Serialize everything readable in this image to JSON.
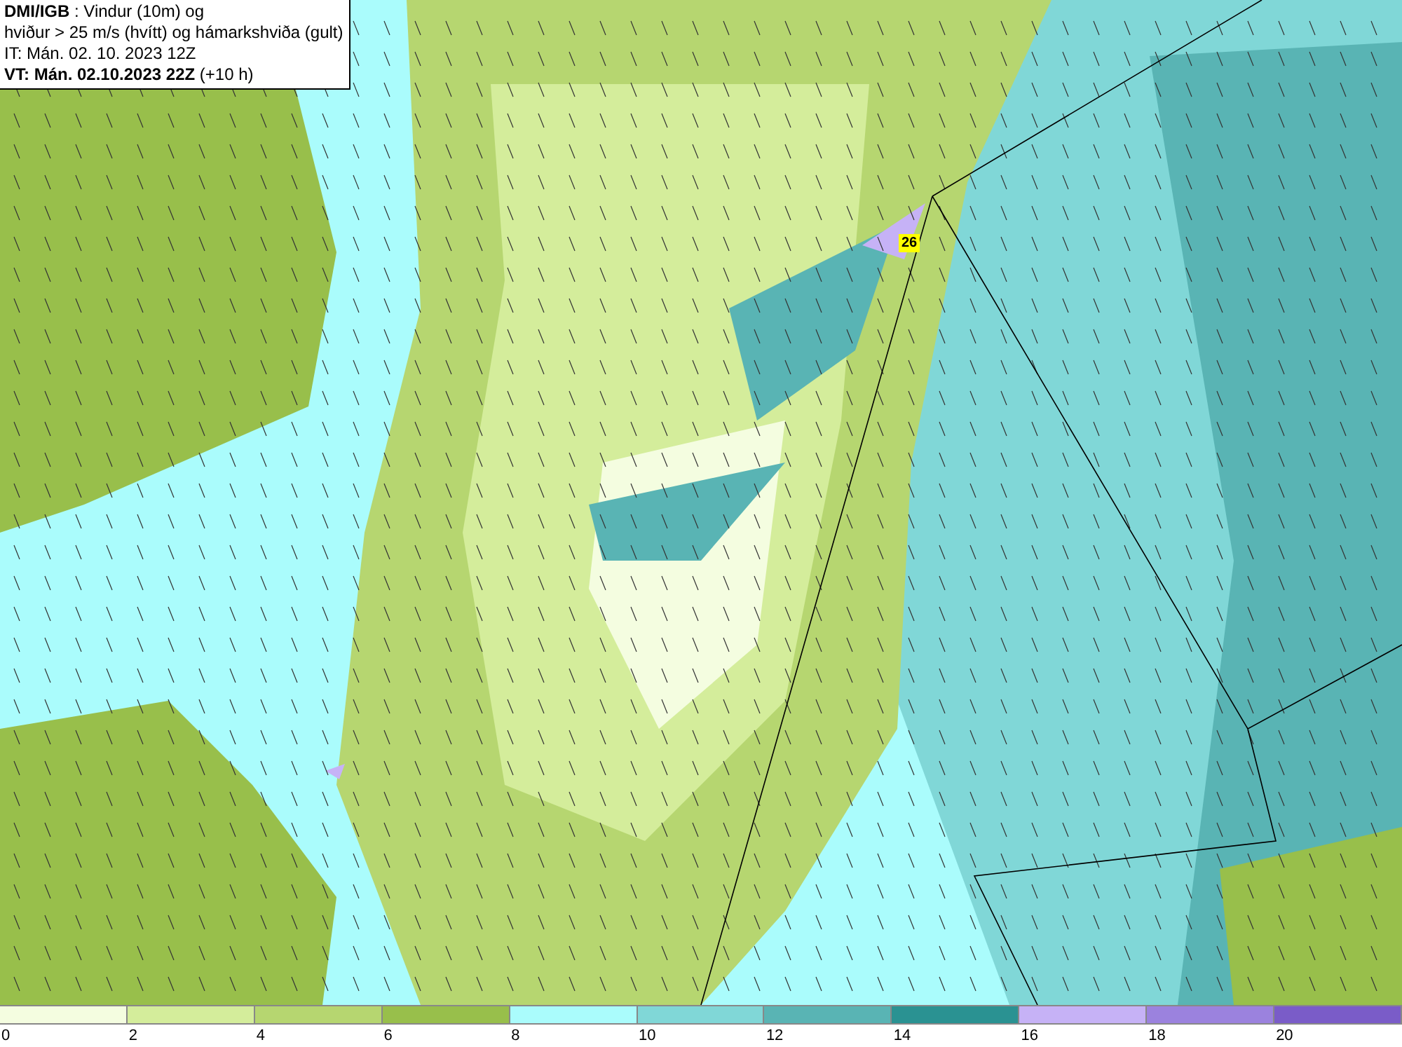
{
  "header": {
    "lines": [
      "**DMI/IGB** : Vindur (10m) og",
      "hviður > 25 m/s (hvítt) og hámarkshviða (gult)",
      "IT: Mán. 02. 10. 2023 12Z",
      "**VT: Mán. 02.10.2023 22Z** (+10 h)"
    ]
  },
  "map": {
    "max_gust_label": "26"
  },
  "legend": {
    "swatches": [
      {
        "color": "#f4fde0",
        "label": "0"
      },
      {
        "color": "#d4ed9b",
        "label": "2"
      },
      {
        "color": "#b6d670",
        "label": "4"
      },
      {
        "color": "#98bf4b",
        "label": "6"
      },
      {
        "color": "#aafcfc",
        "label": "8"
      },
      {
        "color": "#80d7d7",
        "label": "10"
      },
      {
        "color": "#59b4b4",
        "label": "12"
      },
      {
        "color": "#2a9292",
        "label": "14"
      },
      {
        "color": "#c6b2f6",
        "label": "16"
      },
      {
        "color": "#9b82de",
        "label": "18"
      },
      {
        "color": "#7a5cc8",
        "label": "20"
      }
    ]
  }
}
